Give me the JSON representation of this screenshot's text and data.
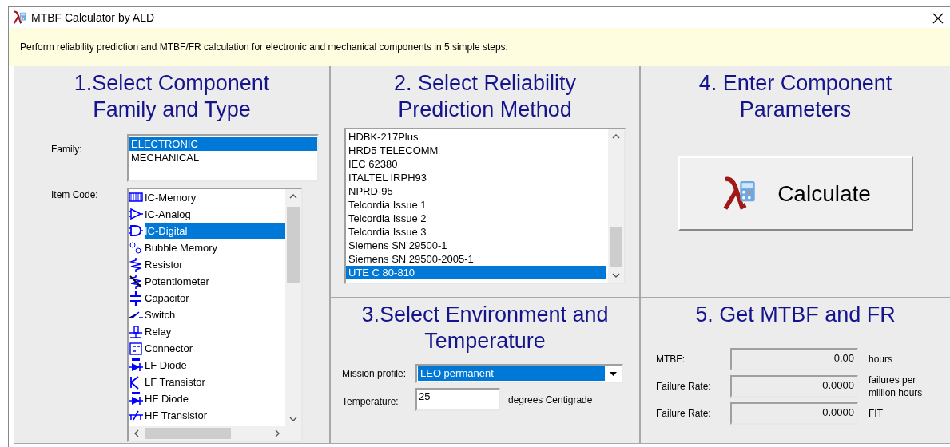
{
  "window": {
    "title": "MTBF Calculator by ALD"
  },
  "intro": "Perform reliability prediction and MTBF/FR calculation for electronic and mechanical components in 5 simple steps:",
  "step1": {
    "heading": "1.Select Component Family and Type",
    "family_label": "Family:",
    "families": [
      {
        "label": "ELECTRONIC",
        "selected": true
      },
      {
        "label": "MECHANICAL",
        "selected": false
      }
    ],
    "item_code_label": "Item Code:",
    "items": [
      {
        "label": "IC-Memory",
        "selected": false
      },
      {
        "label": "IC-Analog",
        "selected": false
      },
      {
        "label": "IC-Digital",
        "selected": true
      },
      {
        "label": "Bubble Memory",
        "selected": false
      },
      {
        "label": "Resistor",
        "selected": false
      },
      {
        "label": "Potentiometer",
        "selected": false
      },
      {
        "label": "Capacitor",
        "selected": false
      },
      {
        "label": "Switch",
        "selected": false
      },
      {
        "label": "Relay",
        "selected": false
      },
      {
        "label": "Connector",
        "selected": false
      },
      {
        "label": "LF Diode",
        "selected": false
      },
      {
        "label": "LF Transistor",
        "selected": false
      },
      {
        "label": "HF Diode",
        "selected": false
      },
      {
        "label": "HF Transistor",
        "selected": false
      }
    ]
  },
  "step2": {
    "heading": "2. Select Reliability Prediction Method",
    "methods": [
      {
        "label": "HDBK-217Plus",
        "selected": false
      },
      {
        "label": "HRD5 TELECOMM",
        "selected": false
      },
      {
        "label": "IEC 62380",
        "selected": false
      },
      {
        "label": "ITALTEL IRPH93",
        "selected": false
      },
      {
        "label": "NPRD-95",
        "selected": false
      },
      {
        "label": "Telcordia Issue 1",
        "selected": false
      },
      {
        "label": "Telcordia Issue 2",
        "selected": false
      },
      {
        "label": "Telcordia Issue 3",
        "selected": false
      },
      {
        "label": "Siemens SN 29500-1",
        "selected": false
      },
      {
        "label": "Siemens SN 29500-2005-1",
        "selected": false
      },
      {
        "label": "UTE C 80-810",
        "selected": true
      }
    ]
  },
  "step3": {
    "heading": "3.Select Environment and Temperature",
    "mission_label": "Mission profile:",
    "mission_value": "LEO permanent",
    "temperature_label": "Temperature:",
    "temperature_value": "25",
    "temperature_unit": "degrees Centigrade"
  },
  "step4": {
    "heading": "4. Enter Component Parameters",
    "button": "Calculate"
  },
  "step5": {
    "heading": "5. Get MTBF and FR",
    "results": [
      {
        "label": "MTBF:",
        "value": "0.00",
        "unit": "hours"
      },
      {
        "label": "Failure Rate:",
        "value": "0.0000",
        "unit": "failures per million hours"
      },
      {
        "label": "Failure Rate:",
        "value": "0.0000",
        "unit": "FIT"
      }
    ]
  }
}
